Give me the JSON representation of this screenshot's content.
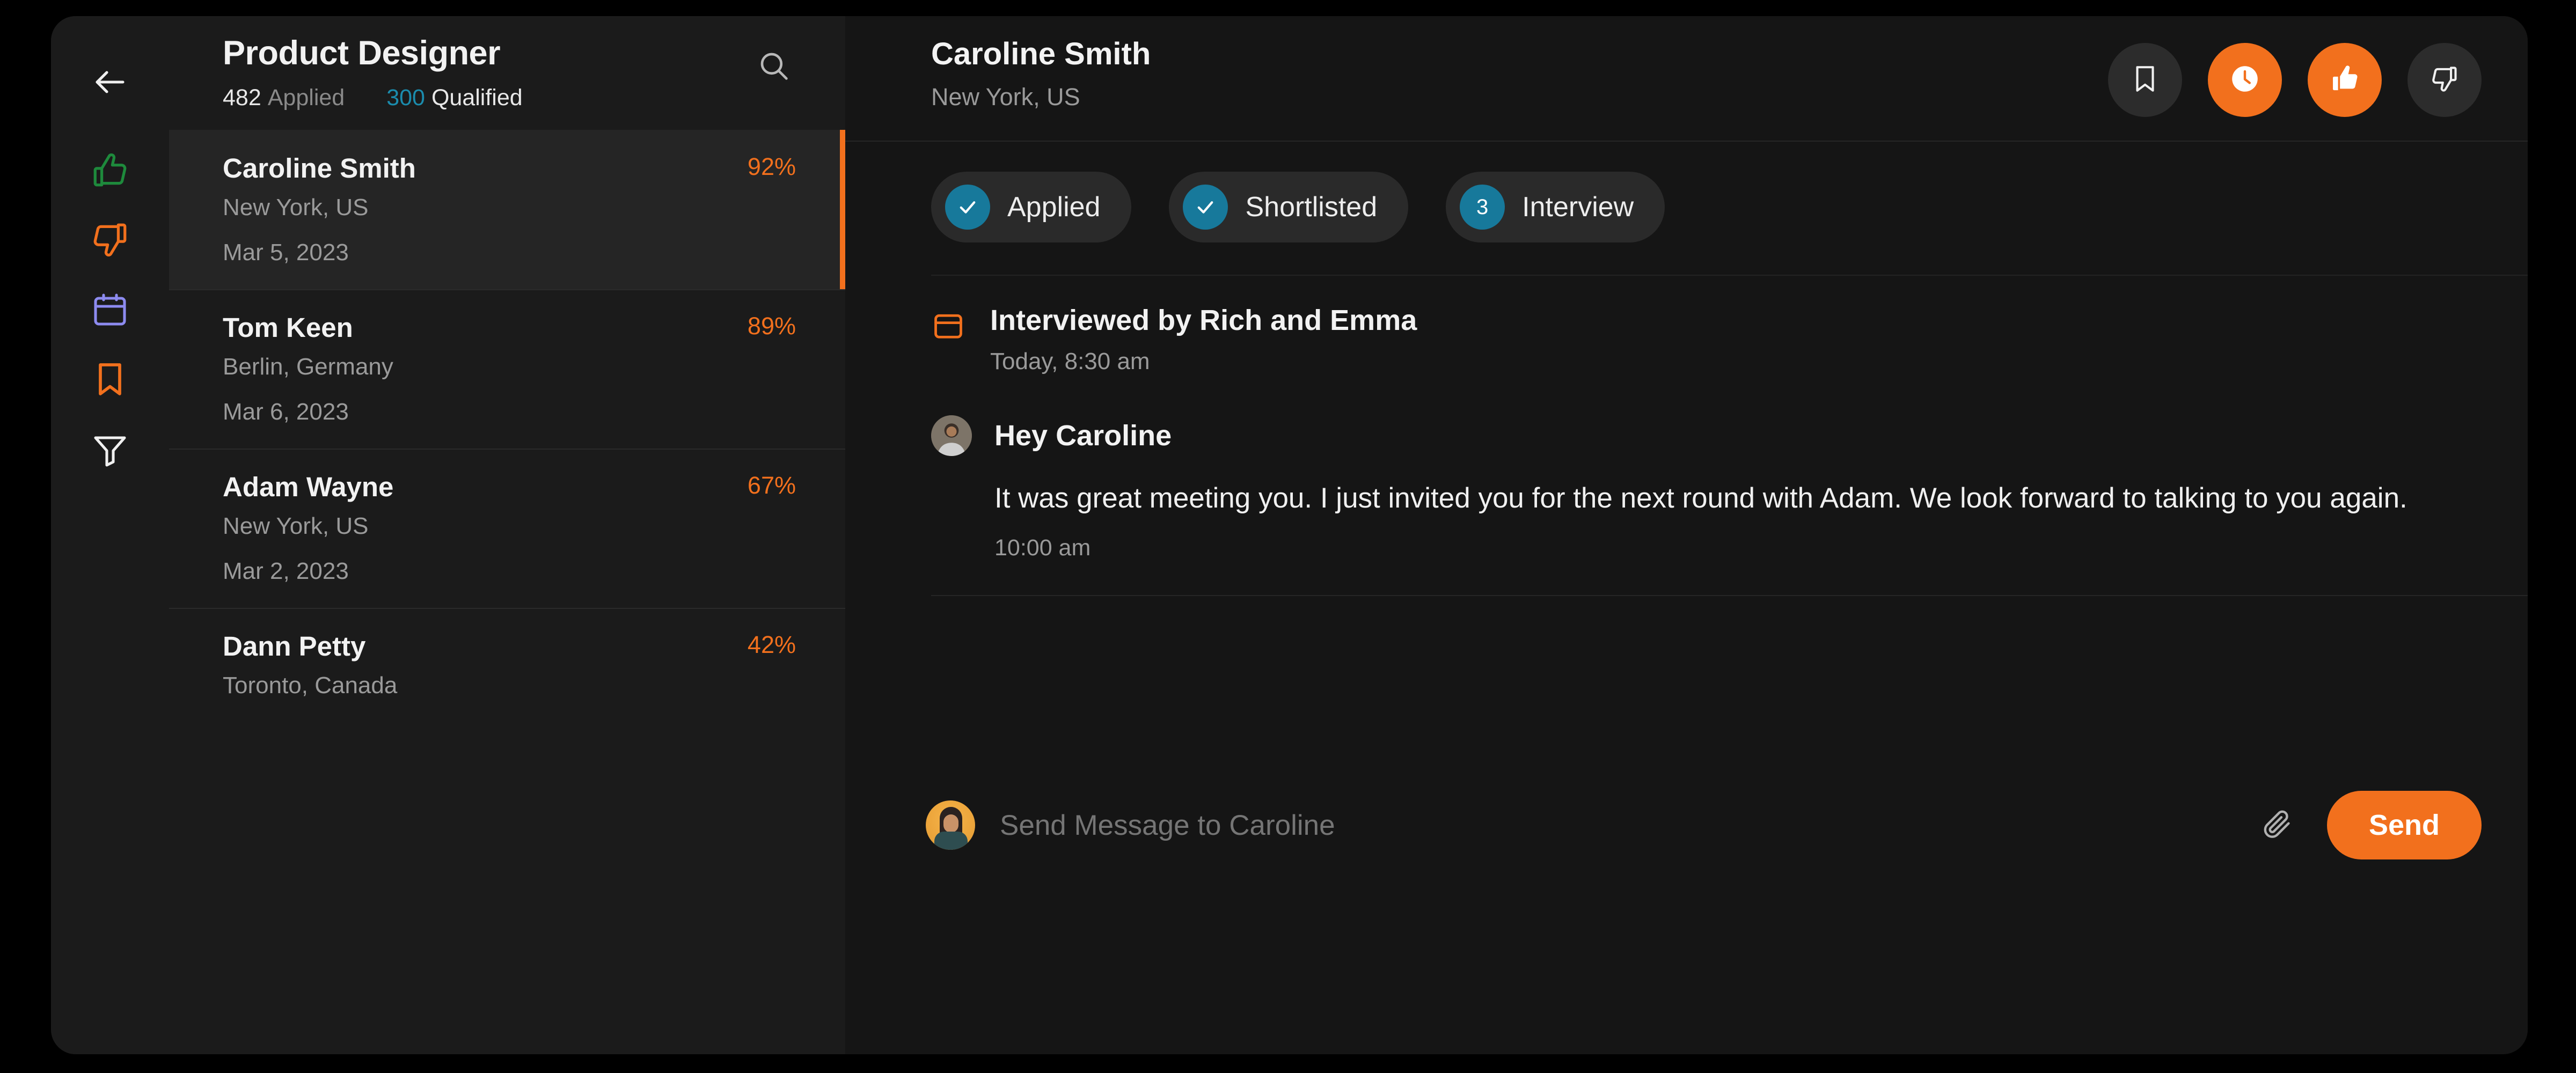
{
  "rail": {
    "back_icon": "arrow-left-icon",
    "items": [
      {
        "icon": "thumbs-up-icon",
        "color": "#1e8a3c"
      },
      {
        "icon": "thumbs-down-icon",
        "color": "#f2701d"
      },
      {
        "icon": "calendar-icon",
        "color": "#8d8bf0"
      },
      {
        "icon": "bookmark-icon",
        "color": "#f2701d"
      },
      {
        "icon": "filter-icon",
        "color": "#ffffff"
      }
    ]
  },
  "list": {
    "title": "Product Designer",
    "applied_count": "482",
    "applied_label": "Applied",
    "qualified_count": "300",
    "qualified_label": "Qualified",
    "search_icon": "search-icon",
    "candidates": [
      {
        "name": "Caroline Smith",
        "location": "New York, US",
        "date": "Mar 5, 2023",
        "match": "92%",
        "selected": true
      },
      {
        "name": "Tom Keen",
        "location": "Berlin, Germany",
        "date": "Mar 6, 2023",
        "match": "89%",
        "selected": false
      },
      {
        "name": "Adam Wayne",
        "location": "New York, US",
        "date": "Mar 2, 2023",
        "match": "67%",
        "selected": false
      },
      {
        "name": "Dann Petty",
        "location": "Toronto, Canada",
        "date": "",
        "match": "42%",
        "selected": false
      }
    ]
  },
  "detail": {
    "name": "Caroline Smith",
    "location": "New York, US",
    "actions": [
      {
        "icon": "bookmark-icon",
        "accent": false
      },
      {
        "icon": "clock-icon",
        "accent": true
      },
      {
        "icon": "thumbs-up-icon",
        "accent": true
      },
      {
        "icon": "thumbs-down-icon",
        "accent": false
      }
    ],
    "stages": [
      {
        "badge": "check",
        "label": "Applied"
      },
      {
        "badge": "check",
        "label": "Shortlisted"
      },
      {
        "badge": "3",
        "label": "Interview"
      }
    ],
    "event": {
      "icon": "card-icon",
      "title": "Interviewed by Rich and Emma",
      "time": "Today, 8:30 am"
    },
    "message": {
      "avatar": "sender-avatar",
      "greeting": "Hey Caroline",
      "body": "It was great meeting you. I just invited you for the next round with Adam. We look forward to talking to you again.",
      "time": "10:00 am"
    },
    "composer": {
      "avatar": "recipient-avatar",
      "placeholder": "Send Message to Caroline",
      "value": "",
      "attach_icon": "paperclip-icon",
      "send_label": "Send"
    }
  },
  "colors": {
    "accent": "#f2701d",
    "teal": "#17799b",
    "green": "#1e8a3c",
    "purple": "#8d8bf0"
  }
}
